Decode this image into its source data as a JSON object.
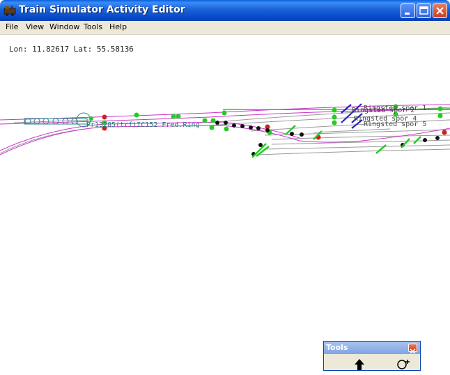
{
  "window": {
    "title": "Train Simulator Activity Editor"
  },
  "menu": {
    "items": [
      "File",
      "View",
      "Window",
      "Tools",
      "Help"
    ]
  },
  "status": {
    "coords": "Lon: 11.82617 Lat: 55.58136"
  },
  "track_labels": {
    "spor1": "Ringsted spor 1",
    "spor2": "Ringsted spor 2",
    "spor4": "Ringsted spor 4",
    "spor5": "Ringsted spor 5",
    "train": "Pr13285(trf)IC152 Fred.Ring"
  },
  "tools_panel": {
    "title": "Tools",
    "tools": [
      "pointer-tool",
      "zoom-in-tool"
    ]
  },
  "colors": {
    "track_main": "#cc33cc",
    "track_gray": "#999999",
    "signal_green": "#22cc22",
    "signal_red": "#cc2222",
    "marker_black": "#111111",
    "platform_blue": "#2222cc",
    "xp_title_blue": "#0548c8"
  }
}
